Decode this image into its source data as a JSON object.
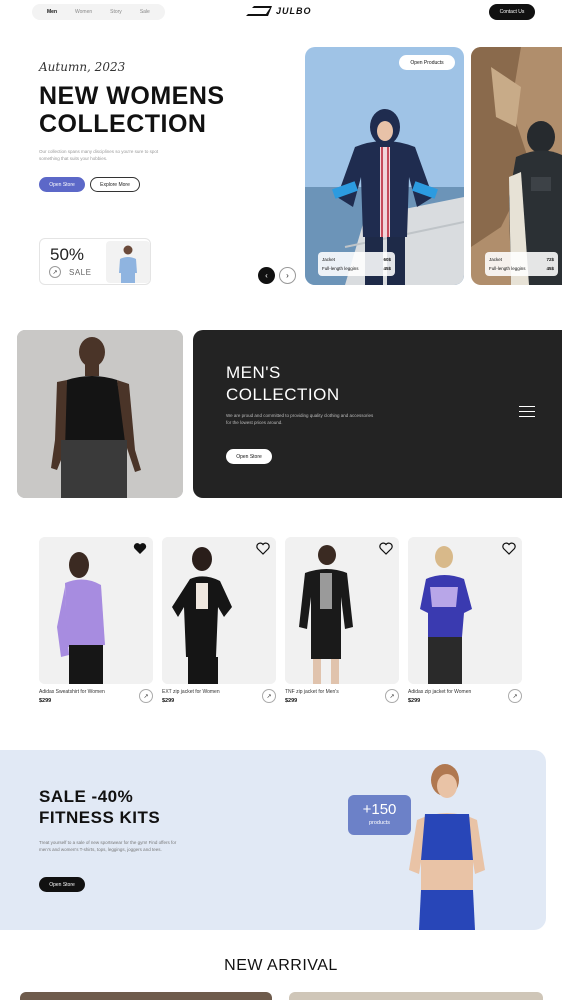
{
  "nav": {
    "links": [
      "Men",
      "Women",
      "Story",
      "Sale"
    ],
    "active": "Men",
    "brand": "JULBO",
    "contact_label": "Contact Us"
  },
  "hero": {
    "kicker": "Autumn, 2023",
    "title": "NEW WOMENS COLLECTION",
    "description": "Our collection spans many disciplines so you're sure to spot something that suits your hobbies.",
    "primary_label": "Open Store",
    "secondary_label": "Explore More",
    "sale": {
      "percent": "50%",
      "label": "SALE"
    },
    "open_products_label": "Open Products",
    "prev_icon": "chevron-left-icon",
    "next_icon": "chevron-right-icon",
    "cards": [
      {
        "rows": [
          {
            "name": "Jacket",
            "price": "60$"
          },
          {
            "name": "Full-length leggins",
            "price": "45$"
          }
        ]
      },
      {
        "rows": [
          {
            "name": "Jacket",
            "price": "72$"
          },
          {
            "name": "Full-length leggins",
            "price": "45$"
          }
        ]
      }
    ]
  },
  "men": {
    "title": "MEN'S COLLECTION",
    "description": "We are proud and committed to providing quality clothing and accessories for the lowest prices around.",
    "button_label": "Open Store"
  },
  "products": [
    {
      "name": "Adidas Sweatshirt for Women",
      "price": "$299",
      "liked": true
    },
    {
      "name": "EXT zip jacket for Women",
      "price": "$299",
      "liked": false
    },
    {
      "name": "TNF zip jacket for Men's",
      "price": "$299",
      "liked": false
    },
    {
      "name": "Adidas zip jacket for Women",
      "price": "$299",
      "liked": false
    }
  ],
  "fitness": {
    "title": "SALE -40% FITNESS KITS",
    "description": "Treat yourself to a sale of new sportswear for the gym! Find offers for men's and women's T-shirts, tops, leggings, joggers and tees.",
    "button_label": "Open Store",
    "count": "+150",
    "count_label": "products"
  },
  "new_arrival": {
    "title": "NEW ARRIVAL"
  },
  "colors": {
    "accent": "#5c68c8",
    "dark_panel": "#232323",
    "fitness_bg": "#e1e9f5",
    "count_card": "#6c81c8"
  }
}
